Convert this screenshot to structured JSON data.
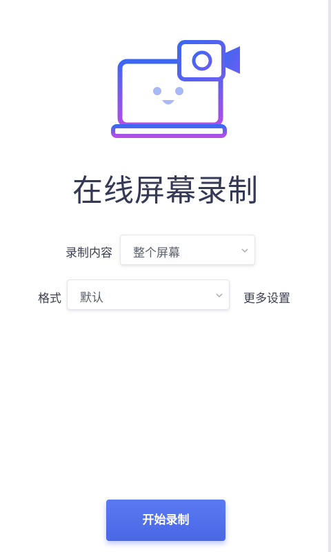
{
  "app": {
    "title": "在线屏幕录制"
  },
  "form": {
    "content_label": "录制内容",
    "content_value": "整个屏幕",
    "format_label": "格式",
    "format_value": "默认",
    "more_settings": "更多设置"
  },
  "actions": {
    "start_label": "开始录制"
  },
  "colors": {
    "accent": "#4f6eec",
    "gradient_top": "#3d67f0",
    "gradient_bottom": "#b34de6",
    "title_text": "#343a55"
  },
  "icons": {
    "hero": "laptop-camera-icon",
    "dropdown": "chevron-down-icon"
  }
}
